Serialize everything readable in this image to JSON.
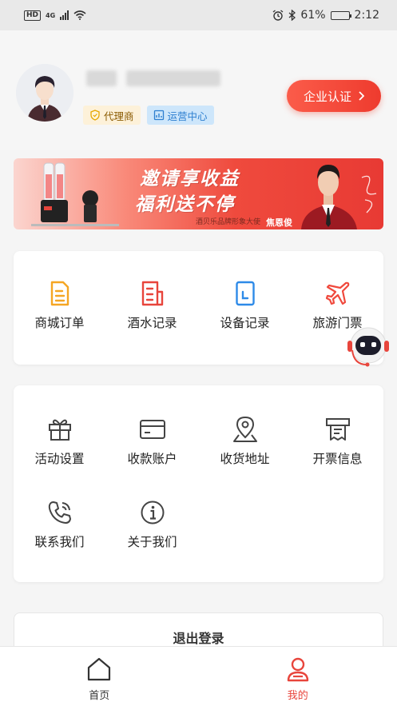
{
  "status_bar": {
    "hd": "HD",
    "network": "4G",
    "battery": "61%",
    "battery_level": 0.61,
    "time": "2:12"
  },
  "profile": {
    "tags": [
      {
        "label": "代理商",
        "icon": "shield-icon"
      },
      {
        "label": "运营中心",
        "icon": "chart-icon"
      }
    ],
    "cert_button": "企业认证"
  },
  "banner": {
    "line1": "邀请享收益",
    "line2": "福利送不停",
    "caption": "酒贝乐品牌形象大使",
    "person": "焦恩俊"
  },
  "menu_primary": [
    {
      "label": "商城订单",
      "icon": "order-icon",
      "color": "#f5a623"
    },
    {
      "label": "酒水记录",
      "icon": "record-icon",
      "color": "#e8453c"
    },
    {
      "label": "设备记录",
      "icon": "device-icon",
      "color": "#2d8ae8"
    },
    {
      "label": "旅游门票",
      "icon": "plane-icon",
      "color": "#f0493d"
    }
  ],
  "menu_secondary": [
    {
      "label": "活动设置",
      "icon": "gift-icon"
    },
    {
      "label": "收款账户",
      "icon": "card-icon"
    },
    {
      "label": "收货地址",
      "icon": "location-icon"
    },
    {
      "label": "开票信息",
      "icon": "invoice-icon"
    },
    {
      "label": "联系我们",
      "icon": "phone-icon"
    },
    {
      "label": "关于我们",
      "icon": "info-icon"
    }
  ],
  "logout": "退出登录",
  "tabbar": {
    "home": "首页",
    "mine": "我的"
  },
  "colors": {
    "accent": "#e8453c",
    "background": "#f5f5f5"
  }
}
